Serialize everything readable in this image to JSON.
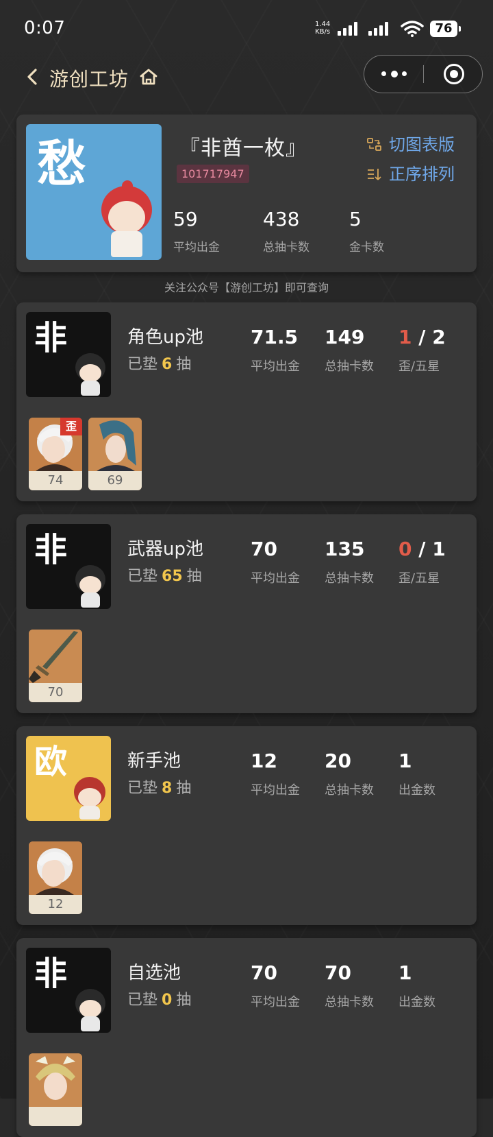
{
  "status_bar": {
    "time": "0:07",
    "net_speed_value": "1.44",
    "net_speed_unit": "KB/s",
    "battery": "76"
  },
  "nav": {
    "title": "游创工坊"
  },
  "profile": {
    "avatar_char": "愁",
    "name": "『非酋一枚』",
    "uid": "101717947",
    "switch_label": "切图表版",
    "sort_label": "正序排列",
    "stats": [
      {
        "value": "59",
        "label": "平均出金"
      },
      {
        "value": "438",
        "label": "总抽卡数"
      },
      {
        "value": "5",
        "label": "金卡数"
      }
    ]
  },
  "notice": "关注公众号【游创工坊】即可查询",
  "pools": [
    {
      "badge": "非",
      "badge_color": "#121212",
      "name": "角色up池",
      "pad_prefix": "已垫",
      "pad_value": "6",
      "pad_suffix": "抽",
      "avg": "71.5",
      "avg_label": "平均出金",
      "total": "149",
      "total_label": "总抽卡数",
      "third_main": "1",
      "third_sep": " / ",
      "third_rest": "2",
      "third_label": "歪/五星",
      "thumbs": [
        {
          "num": "74",
          "tag": "歪"
        },
        {
          "num": "69"
        }
      ]
    },
    {
      "badge": "非",
      "badge_color": "#121212",
      "name": "武器up池",
      "pad_prefix": "已垫",
      "pad_value": "65",
      "pad_suffix": "抽",
      "avg": "70",
      "avg_label": "平均出金",
      "total": "135",
      "total_label": "总抽卡数",
      "third_main": "0",
      "third_sep": " / ",
      "third_rest": "1",
      "third_label": "歪/五星",
      "thumbs": [
        {
          "num": "70"
        }
      ]
    },
    {
      "badge": "欧",
      "badge_color": "#efc24f",
      "name": "新手池",
      "pad_prefix": "已垫",
      "pad_value": "8",
      "pad_suffix": "抽",
      "avg": "12",
      "avg_label": "平均出金",
      "total": "20",
      "total_label": "总抽卡数",
      "third_main": "1",
      "third_label": "出金数",
      "thumbs": [
        {
          "num": "12"
        }
      ]
    },
    {
      "badge": "非",
      "badge_color": "#121212",
      "name": "自选池",
      "pad_prefix": "已垫",
      "pad_value": "0",
      "pad_suffix": "抽",
      "avg": "70",
      "avg_label": "平均出金",
      "total": "70",
      "total_label": "总抽卡数",
      "third_main": "1",
      "third_label": "出金数",
      "thumbs": [
        {
          "num": ""
        }
      ]
    }
  ],
  "colors": {
    "accent_blue": "#6fa7e8",
    "highlight_gold": "#f2c64d",
    "red": "#e25c4a",
    "uid_pink": "#e98aa0",
    "card_bg": "#383838"
  }
}
